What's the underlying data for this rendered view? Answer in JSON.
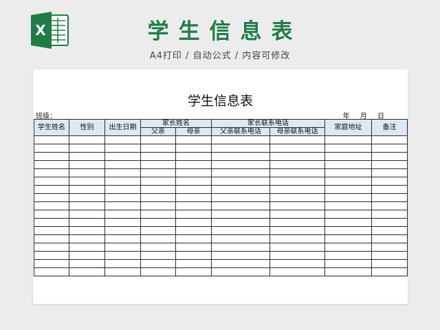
{
  "banner": {
    "title": "学生信息表",
    "subtitle": "A4打印 / 自动公式 / 内容可修改",
    "icon": "excel-icon",
    "accent": "#1e7c47"
  },
  "sheet": {
    "title": "学生信息表",
    "class_label": "班级：",
    "date_label": "年 月 日",
    "header_bg": "#dde8f3",
    "headers": {
      "student_name": "学生姓名",
      "gender": "性别",
      "birth_date": "出生日期",
      "parent_name": "家长姓名",
      "father": "父亲",
      "mother": "母亲",
      "parent_phone": "家长联系电话",
      "father_phone": "父亲联系电话",
      "mother_phone": "母亲联系电话",
      "address": "家庭地址",
      "remark": "备注"
    },
    "blank_rows": 17
  }
}
